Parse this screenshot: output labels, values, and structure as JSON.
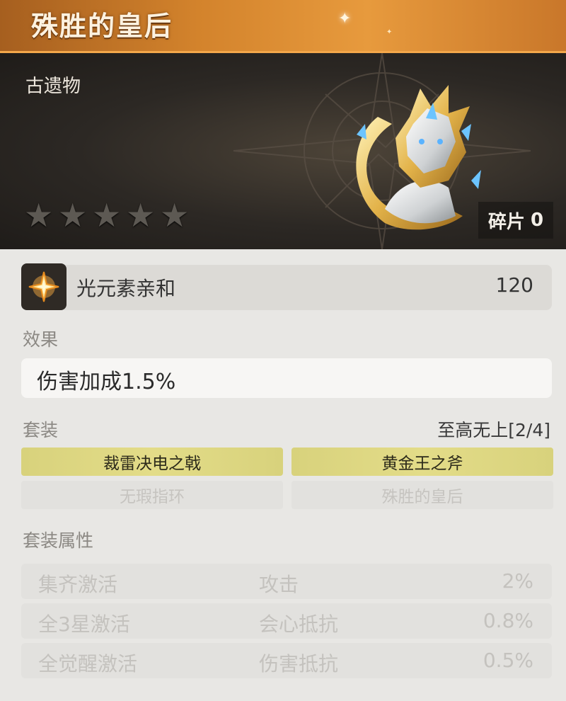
{
  "title": "殊胜的皇后",
  "category": "古遗物",
  "rarity": {
    "stars_filled": 0,
    "stars_total": 5
  },
  "fragments": {
    "label": "碎片",
    "count": "0"
  },
  "attribute": {
    "icon": "light-element-icon",
    "name": "光元素亲和",
    "value": "120"
  },
  "effect": {
    "label": "效果",
    "text": "伤害加成1.5%"
  },
  "set": {
    "label": "套装",
    "name_progress": "至高无上[2/4]",
    "items": [
      {
        "name": "裁雷决电之戟",
        "active": true
      },
      {
        "name": "黄金王之斧",
        "active": true
      },
      {
        "name": "无瑕指环",
        "active": false
      },
      {
        "name": "殊胜的皇后",
        "active": false
      }
    ]
  },
  "set_bonus": {
    "label": "套装属性",
    "rows": [
      {
        "condition": "集齐激活",
        "stat": "攻击",
        "value": "2%"
      },
      {
        "condition": "全3星激活",
        "stat": "会心抵抗",
        "value": "0.8%"
      },
      {
        "condition": "全觉醒激活",
        "stat": "伤害抵抗",
        "value": "0.5%"
      }
    ]
  },
  "colors": {
    "title_bar": "#d3832c",
    "set_active": "#e3dc88",
    "hero_bg": "#2c2824"
  }
}
